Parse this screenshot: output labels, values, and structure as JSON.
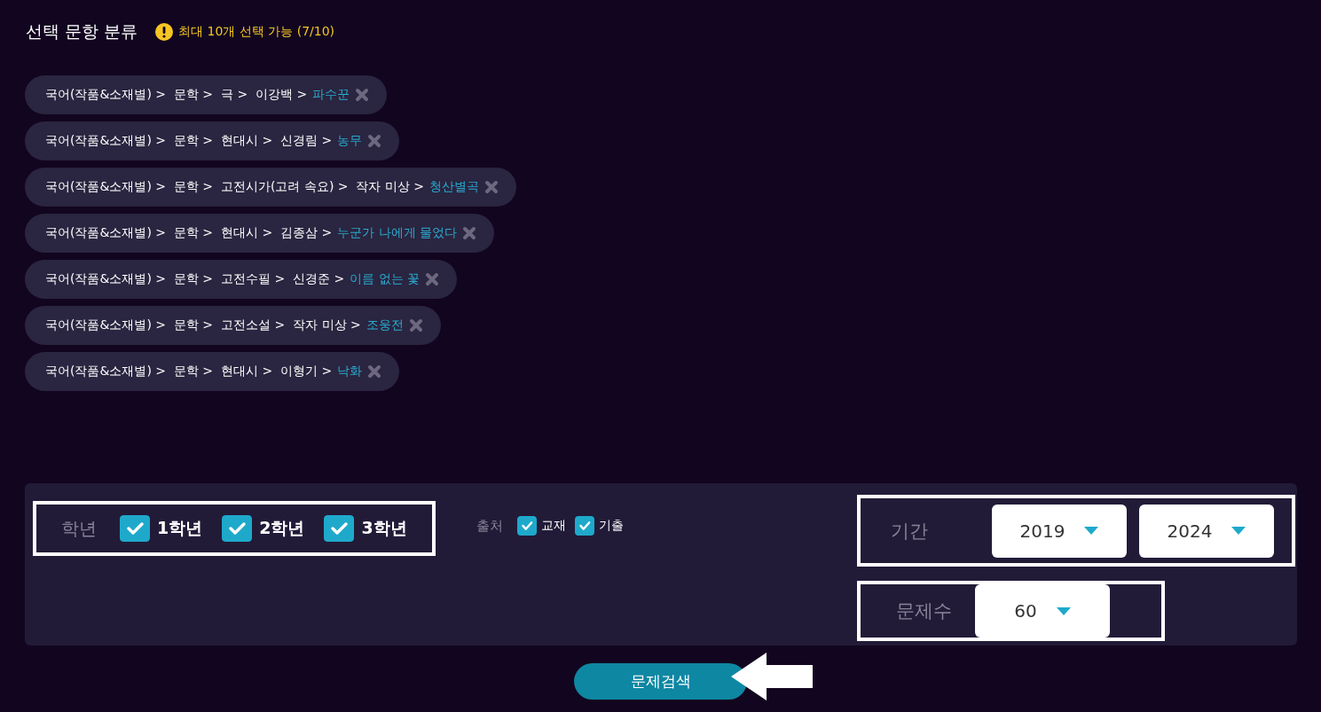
{
  "header": {
    "title": "선택 문항 분류",
    "notice": "최대 10개 선택 가능 (7/10)"
  },
  "chips": [
    {
      "path": "국어(작품&소재별) >  문학 >  극 >  이강백 >",
      "leaf": "파수꾼"
    },
    {
      "path": "국어(작품&소재별) >  문학 >  현대시 >  신경림 >",
      "leaf": "농무"
    },
    {
      "path": "국어(작품&소재별) >  문학 >  고전시가(고려 속요) >  작자 미상 >",
      "leaf": "청산별곡"
    },
    {
      "path": "국어(작품&소재별) >  문학 >  현대시 >  김종삼 >",
      "leaf": "누군가 나에게 물었다"
    },
    {
      "path": "국어(작품&소재별) >  문학 >  고전수필 >  신경준 >",
      "leaf": "이름 없는 꽃"
    },
    {
      "path": "국어(작품&소재별) >  문학 >  고전소설 >  작자 미상 >",
      "leaf": "조웅전"
    },
    {
      "path": "국어(작품&소재별) >  문학 >  현대시 >  이형기 >",
      "leaf": "낙화"
    }
  ],
  "filters": {
    "grade": {
      "label": "학년",
      "options": [
        {
          "label": "1학년",
          "checked": true
        },
        {
          "label": "2학년",
          "checked": true
        },
        {
          "label": "3학년",
          "checked": true
        }
      ]
    },
    "source": {
      "label": "출처",
      "options": [
        {
          "label": "교재",
          "checked": true
        },
        {
          "label": "기출",
          "checked": true
        }
      ]
    },
    "period": {
      "label": "기간",
      "from": "2019",
      "to": "2024"
    },
    "count": {
      "label": "문제수",
      "value": "60"
    }
  },
  "search_button": "문제검색"
}
